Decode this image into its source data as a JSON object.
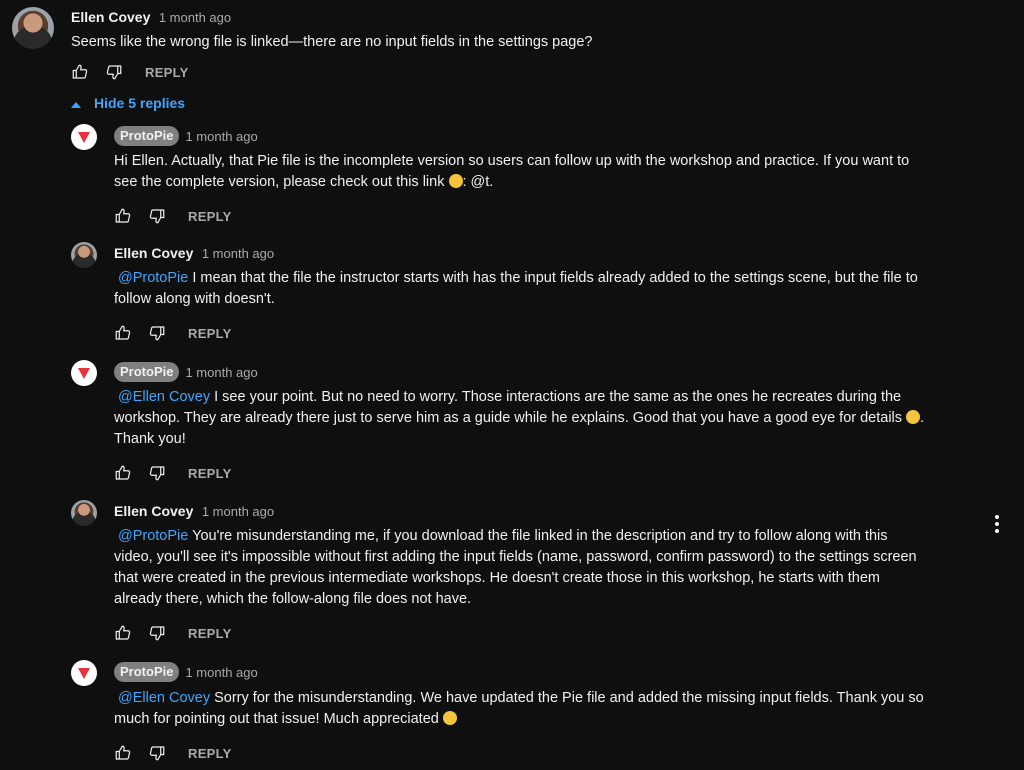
{
  "top_comment": {
    "author": "Ellen Covey",
    "time": "1 month ago",
    "text": "Seems like the wrong file is linked—there are no input fields in the settings page?",
    "reply_label": "REPLY"
  },
  "replies_toggle": {
    "label": "Hide 5 replies",
    "icon": "caret-up-icon"
  },
  "replies": [
    {
      "author": "ProtoPie",
      "time": "1 month ago",
      "text_lines": [
        "Hi Ellen. Actually, that Pie file is the incomplete version so users can follow up with the workshop and practice. If you want to",
        "see the complete version, please check out this link",
        ": @t."
      ],
      "reply_label": "REPLY"
    },
    {
      "author": "Ellen Covey",
      "time": "1 month ago",
      "mention": "@ProtoPie",
      "text_lines": [
        " I mean that the file the instructor starts with has the input fields already added to the settings scene, but the file to",
        "follow along with doesn't."
      ],
      "reply_label": "REPLY"
    },
    {
      "author": "ProtoPie",
      "time": "1 month ago",
      "mention": "@Ellen Covey",
      "text_lines": [
        " I see your point. But no need to worry. Those interactions are the same as the ones he recreates during the",
        "workshop. They are already there just to serve him as a guide while he explains. Good that you have a good eye for details",
        ".",
        "Thank you!"
      ],
      "reply_label": "REPLY"
    },
    {
      "author": "Ellen Covey",
      "time": "1 month ago",
      "mention": "@ProtoPie",
      "text_lines": [
        " You're misunderstanding me, if you download the file linked in the description and try to follow along with this",
        "video, you'll see it's impossible without first adding the input fields (name, password, confirm password) to the settings screen",
        "that were created in the previous intermediate workshops. He doesn't create those in this workshop, he starts with them",
        "already there, which the follow-along file does not have."
      ],
      "reply_label": "REPLY"
    },
    {
      "author": "ProtoPie",
      "time": "1 month ago",
      "mention": "@Ellen Covey",
      "text_lines": [
        " Sorry for the misunderstanding. We have updated the Pie file and added the missing input fields. Thank you so",
        "much for pointing out that issue! Much appreciated"
      ],
      "reply_label": "REPLY"
    }
  ],
  "icons": {
    "like": "thumbs-up-icon",
    "dislike": "thumbs-down-icon",
    "menu": "more-vert-icon",
    "protopie_logo": "protopie-logo-icon"
  },
  "colors": {
    "background": "#0f0f0f",
    "link": "#3ea6ff",
    "badge": "#808080",
    "secondary": "#aaaaaa"
  }
}
